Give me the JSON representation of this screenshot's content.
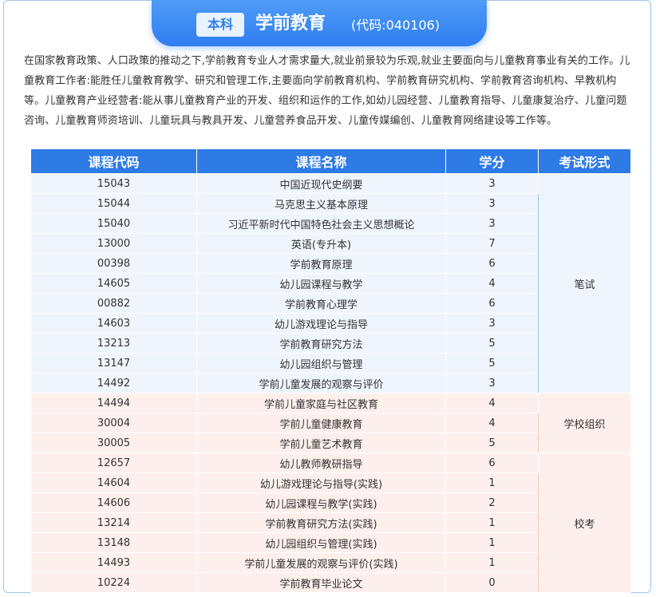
{
  "header": {
    "badge": "本科",
    "major_name": "学前教育",
    "major_code": "(代码:040106)"
  },
  "intro": "在国家教育政策、人口政策的推动之下,学前教育专业人才需求量大,就业前景较为乐观,就业主要面向与儿童教育事业有关的工作。儿童教育工作者:能胜任儿童教育教学、研究和管理工作,主要面向学前教育机构、学前教育研究机构、学前教育咨询机构、早教机构等。儿童教育产业经营者:能从事儿童教育产业的开发、组织和运作的工作,如幼儿园经营、儿童教育指导、儿童康复治疗、儿童问题咨询、儿童教育师资培训、儿童玩具与教具开发、儿童营养食品开发、儿童传媒编创、儿童教育网络建设等工作等。",
  "table": {
    "headers": [
      "课程代码",
      "课程名称",
      "学分",
      "考试形式"
    ],
    "groups": [
      {
        "exam_form": "笔试",
        "theme": "blue",
        "rows": [
          {
            "code": "15043",
            "name": "中国近现代史纲要",
            "credit": "3"
          },
          {
            "code": "15044",
            "name": "马克思主义基本原理",
            "credit": "3"
          },
          {
            "code": "15040",
            "name": "习近平新时代中国特色社会主义思想概论",
            "credit": "3"
          },
          {
            "code": "13000",
            "name": "英语(专升本)",
            "credit": "7"
          },
          {
            "code": "00398",
            "name": "学前教育原理",
            "credit": "6"
          },
          {
            "code": "14605",
            "name": "幼儿园课程与教学",
            "credit": "4"
          },
          {
            "code": "00882",
            "name": "学前教育心理学",
            "credit": "6"
          },
          {
            "code": "14603",
            "name": "幼儿游戏理论与指导",
            "credit": "3"
          },
          {
            "code": "13213",
            "name": "学前教育研究方法",
            "credit": "5"
          },
          {
            "code": "13147",
            "name": "幼儿园组织与管理",
            "credit": "5"
          },
          {
            "code": "14492",
            "name": "学前儿童发展的观察与评价",
            "credit": "3"
          }
        ]
      },
      {
        "exam_form": "学校组织",
        "theme": "pink",
        "rows": [
          {
            "code": "14494",
            "name": "学前儿童家庭与社区教育",
            "credit": "4"
          },
          {
            "code": "30004",
            "name": "学前儿童健康教育",
            "credit": "4"
          },
          {
            "code": "30005",
            "name": "学前儿童艺术教育",
            "credit": "5"
          }
        ]
      },
      {
        "exam_form": "校考",
        "theme": "pink",
        "rows": [
          {
            "code": "12657",
            "name": "幼儿教师教研指导",
            "credit": "6"
          },
          {
            "code": "14604",
            "name": "幼儿游戏理论与指导(实践)",
            "credit": "1"
          },
          {
            "code": "14606",
            "name": "幼儿园课程与教学(实践)",
            "credit": "2"
          },
          {
            "code": "13214",
            "name": "学前教育研究方法(实践)",
            "credit": "1"
          },
          {
            "code": "13148",
            "name": "幼儿园组织与管理(实践)",
            "credit": "1"
          },
          {
            "code": "14493",
            "name": "学前儿童发展的观察与评价(实践)",
            "credit": "1"
          },
          {
            "code": "10224",
            "name": "学前教育毕业论文",
            "credit": "0"
          }
        ]
      }
    ]
  }
}
